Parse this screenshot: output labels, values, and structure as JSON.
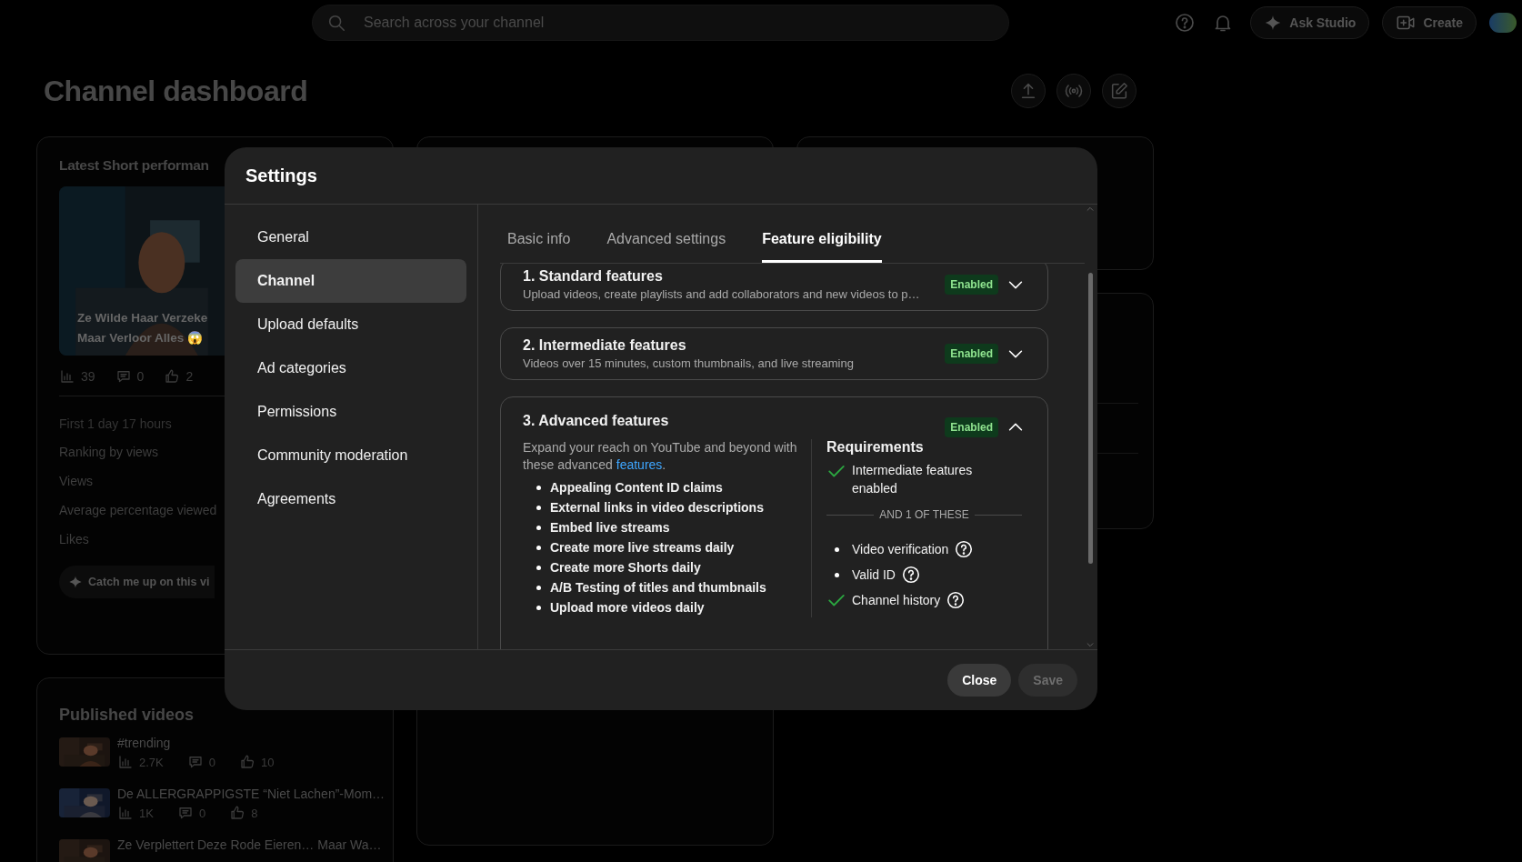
{
  "topbar": {
    "search": {
      "placeholder": "Search across your channel"
    },
    "ask_button": "Ask Studio",
    "create_button": "Create"
  },
  "page_title": "Channel dashboard",
  "short_card": {
    "title": "Latest Short performan",
    "video_title_lines": [
      "Ze Wilde Haar Verzeke",
      "Maar Verloor Alles 😱"
    ],
    "views": "39",
    "comments": "0",
    "likes": "2",
    "period": "First 1 day 17 hours",
    "metrics": [
      "Ranking by views",
      "Views",
      "Average percentage viewed",
      "Likes"
    ],
    "catch_up": "Catch me up on this vi"
  },
  "published": {
    "title": "Published videos",
    "videos": [
      {
        "title": "#trending",
        "views": "2.7K",
        "comments": "0",
        "likes": "10"
      },
      {
        "title": "De ALLERGRAPPIGSTE “Niet Lachen”-Mom…",
        "views": "1K",
        "comments": "0",
        "likes": "8"
      },
      {
        "title": "Ze Verplettert Deze Rode Eieren… Maar Wa…"
      }
    ]
  },
  "settings": {
    "title": "Settings",
    "nav": [
      {
        "label": "General",
        "selected": false
      },
      {
        "label": "Channel",
        "selected": true
      },
      {
        "label": "Upload defaults",
        "selected": false
      },
      {
        "label": "Ad categories",
        "selected": false
      },
      {
        "label": "Permissions",
        "selected": false
      },
      {
        "label": "Community moderation",
        "selected": false
      },
      {
        "label": "Agreements",
        "selected": false
      }
    ],
    "tabs": [
      {
        "label": "Basic info",
        "selected": false
      },
      {
        "label": "Advanced settings",
        "selected": false
      },
      {
        "label": "Feature eligibility",
        "selected": true
      }
    ],
    "features": [
      {
        "title": "1. Standard features",
        "description": "Upload videos, create playlists and add collaborators and new videos to p…",
        "status": "Enabled",
        "expanded": false
      },
      {
        "title": "2. Intermediate features",
        "description": "Videos over 15 minutes, custom thumbnails, and live streaming",
        "status": "Enabled",
        "expanded": false
      },
      {
        "title": "3. Advanced features",
        "status": "Enabled",
        "expanded": true,
        "intro": {
          "before": "Expand your reach on YouTube and beyond with these advanced ",
          "link": "features",
          "after": "."
        },
        "benefits": [
          "Appealing Content ID claims",
          "External links in video descriptions",
          "Embed live streams",
          "Create more live streams daily",
          "Create more Shorts daily",
          "A/B Testing of titles and thumbnails",
          "Upload more videos daily"
        ],
        "requirements": {
          "title": "Requirements",
          "required": [
            {
              "label": "Intermediate features enabled",
              "met": true,
              "help": false
            }
          ],
          "separator": "AND 1 OF THESE",
          "options": [
            {
              "label": "Video verification",
              "met": false,
              "help": true
            },
            {
              "label": "Valid ID",
              "met": false,
              "help": true
            },
            {
              "label": "Channel history",
              "met": true,
              "help": true
            }
          ]
        }
      }
    ],
    "buttons": [
      {
        "label": "Close",
        "disabled": false
      },
      {
        "label": "Save",
        "disabled": true
      }
    ]
  }
}
